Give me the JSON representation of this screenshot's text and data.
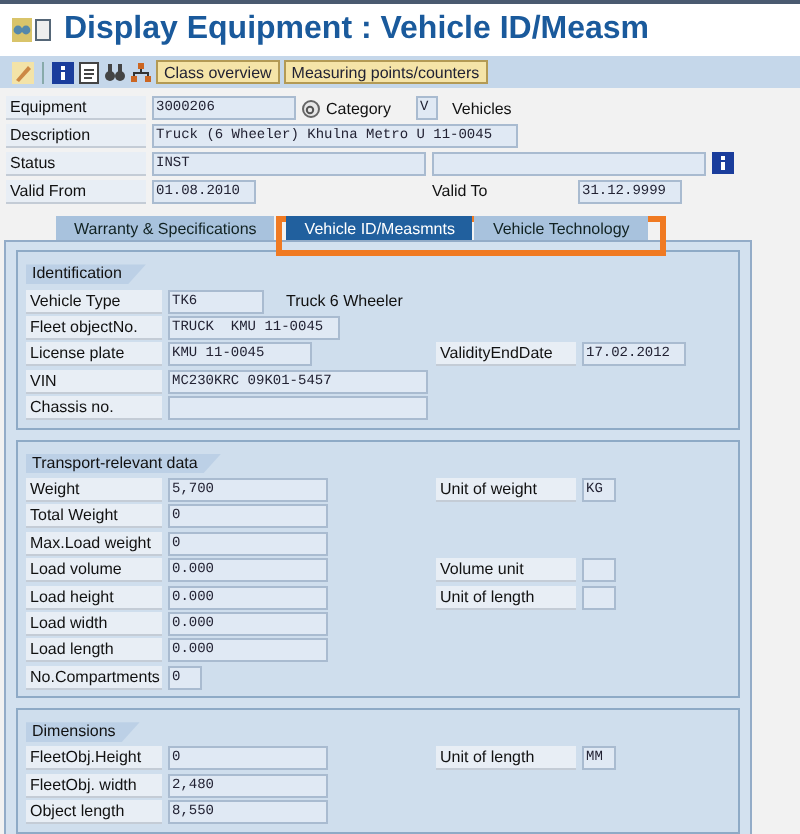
{
  "window": {
    "title": "Display Equipment : Vehicle ID/Measm"
  },
  "toolbar": {
    "buttons": [
      {
        "kind": "icon"
      },
      {
        "kind": "icon"
      },
      {
        "kind": "icon"
      },
      {
        "kind": "icon"
      },
      {
        "kind": "icon"
      },
      {
        "kind": "text",
        "label": "Class overview"
      },
      {
        "kind": "text",
        "label": "Measuring points/counters"
      }
    ]
  },
  "header": [
    {
      "label": "Equipment",
      "fields": [
        {
          "value": "3000206"
        }
      ],
      "extra": {
        "label": "Category",
        "value": "V",
        "text": "Vehicles"
      }
    },
    {
      "label": "Description",
      "fields": [
        {
          "value": "Truck (6 Wheeler) Khulna Metro U 11-0045"
        }
      ]
    },
    {
      "label": "Status",
      "fields": [
        {
          "kind": "text",
          "value": "INST"
        },
        {
          "kind": "blank"
        }
      ],
      "info": true
    },
    {
      "label": "Valid From",
      "fields": [
        {
          "value": "01.08.2010"
        }
      ],
      "right": {
        "label": "Valid To",
        "value": "31.12.9999"
      }
    }
  ],
  "tabs": [
    {
      "label": "Warranty & Specifications",
      "selected": false
    },
    {
      "label": "Vehicle ID/Measmnts",
      "selected": true
    },
    {
      "label": "Vehicle Technology",
      "selected": false
    }
  ],
  "groups": [
    {
      "title": "Identification",
      "rows": [
        {
          "label": "Vehicle Type",
          "value": "TK6",
          "note": "Truck 6 Wheeler"
        },
        {
          "label": "Fleet objectNo.",
          "value": "TRUCK  KMU 11-0045"
        },
        {
          "label": "License plate",
          "value": "KMU 11-0045",
          "right": {
            "label": "ValidityEndDate",
            "value": "17.02.2012"
          }
        },
        {
          "label": "VIN",
          "value": "MC230KRC 09K01-5457"
        },
        {
          "label": "Chassis no."
        }
      ]
    },
    {
      "title": "Transport-relevant data",
      "rows": [
        {
          "label": "Weight",
          "value": "5,700",
          "right": {
            "label": "Unit of weight",
            "value": "KG"
          }
        },
        {
          "label": "Total Weight",
          "value": "0"
        },
        {
          "label": "Max.Load weight",
          "value": "0"
        },
        {
          "label": "Load volume",
          "value": "0.000",
          "right": {
            "label": "Volume unit"
          }
        },
        {
          "label": "Load height",
          "value": "0.000",
          "right": {
            "label": "Unit of length"
          }
        },
        {
          "label": "Load width",
          "value": "0.000"
        },
        {
          "label": "Load length",
          "value": "0.000"
        },
        {
          "label": "No.Compartments",
          "value": "0"
        }
      ]
    },
    {
      "title": "Dimensions",
      "rows": [
        {
          "label": "FleetObj.Height",
          "value": "0",
          "right": {
            "label": "Unit of length",
            "value": "MM"
          }
        },
        {
          "label": "FleetObj. width",
          "value": "2,480"
        },
        {
          "label": "Object length",
          "value": "8,550"
        }
      ]
    }
  ]
}
